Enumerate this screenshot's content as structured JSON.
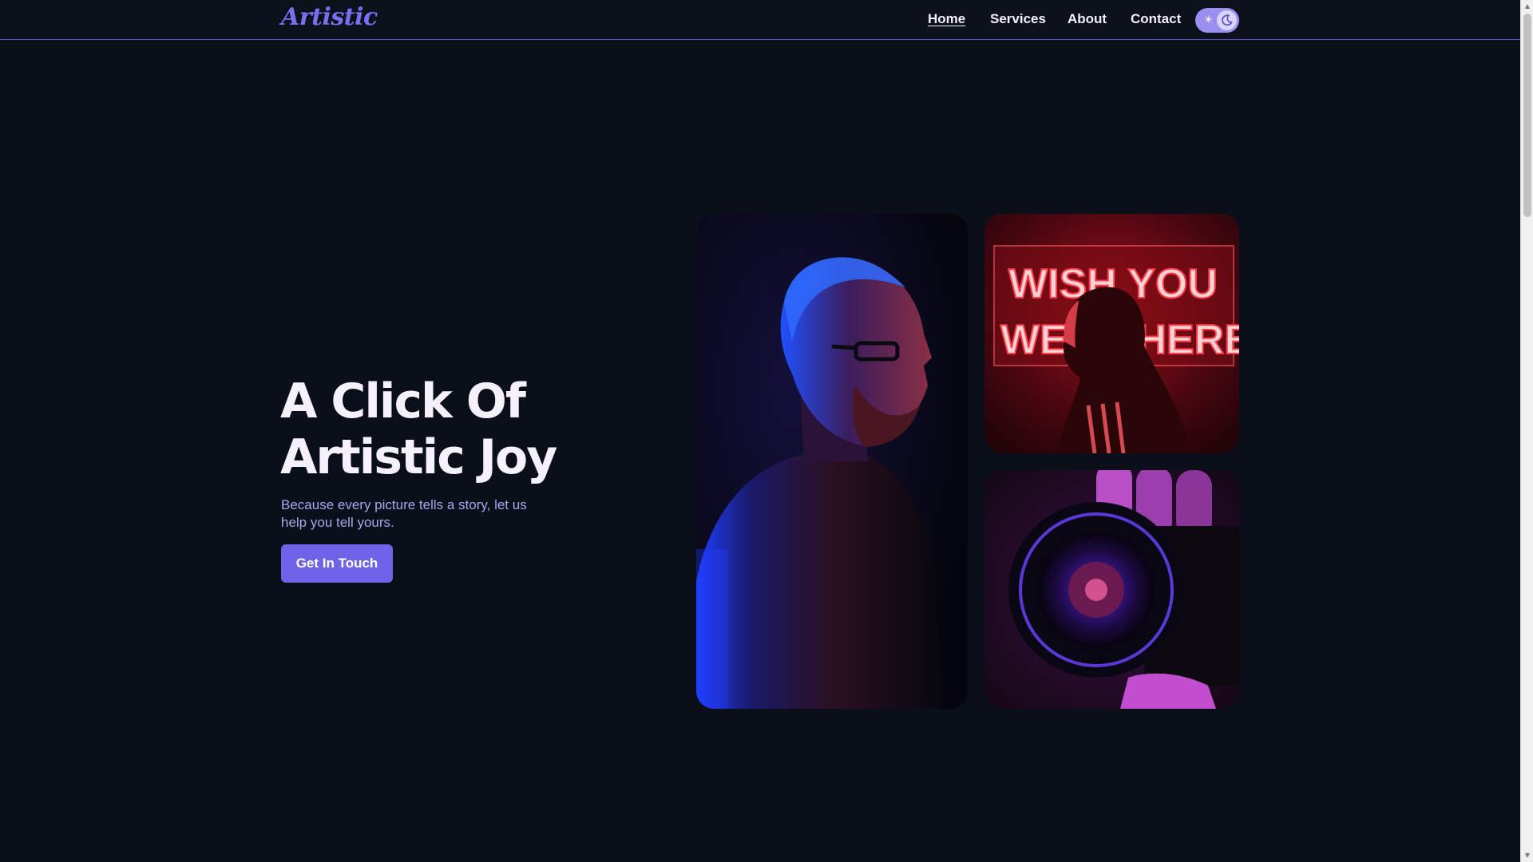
{
  "header": {
    "logo": "Artistic",
    "nav": [
      {
        "label": "Home",
        "active": true
      },
      {
        "label": "Services",
        "active": false
      },
      {
        "label": "About",
        "active": false
      },
      {
        "label": "Contact",
        "active": false
      }
    ],
    "theme_toggle": {
      "icons": [
        "sun-icon",
        "moon-icon"
      ],
      "state": "dark"
    }
  },
  "hero": {
    "title_line1": "A Click Of",
    "title_line2": "Artistic Joy",
    "subtitle": "Because every picture tells a story, let us help you tell yours.",
    "cta_label": "Get In Touch"
  },
  "gallery": {
    "neon_sign_line1": "WISH YOU",
    "neon_sign_line2": "WERE HERE"
  },
  "colors": {
    "background": "#0b0f1a",
    "accent": "#6f63e8",
    "logo": "#7b6ef2",
    "subtitle": "#a9a6ef",
    "header_border": "#5b50c9"
  }
}
